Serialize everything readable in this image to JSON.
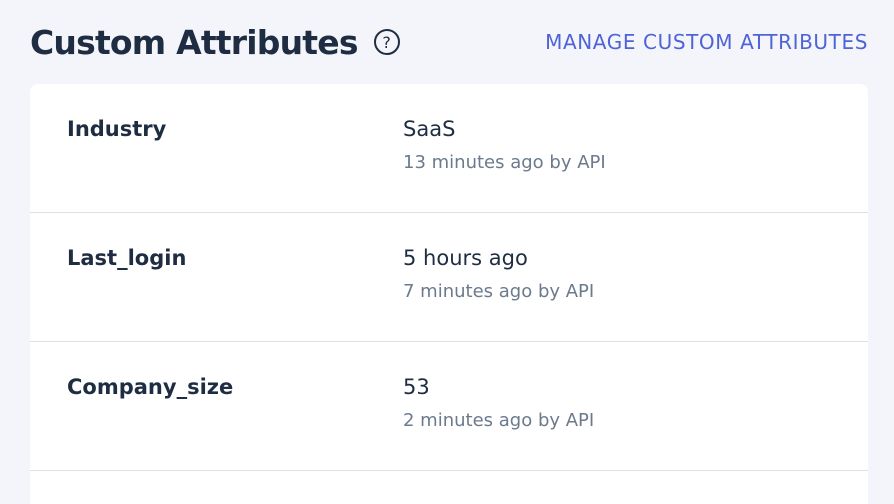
{
  "header": {
    "title": "Custom Attributes",
    "help_icon": "question-circle-icon",
    "help_glyph": "?",
    "manage_label": "MANAGE CUSTOM ATTRIBUTES"
  },
  "attributes": [
    {
      "name": "Industry",
      "value": "SaaS",
      "meta": "13 minutes ago by API"
    },
    {
      "name": "Last_login",
      "value": "5 hours ago",
      "meta": "7 minutes ago by API"
    },
    {
      "name": "Company_size",
      "value": "53",
      "meta": "2 minutes ago by API"
    }
  ],
  "colors": {
    "background": "#f3f5fa",
    "card": "#ffffff",
    "heading": "#1f2d43",
    "link": "#4f63d6",
    "muted": "#6b7a8c",
    "divider": "#dde1e7"
  }
}
